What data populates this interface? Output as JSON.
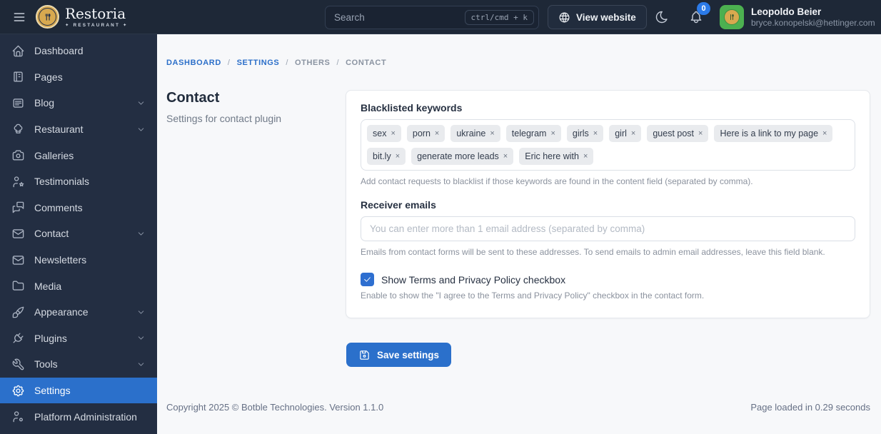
{
  "brand": {
    "name": "Restoria",
    "tagline": "✦ RESTAURANT ✦"
  },
  "topbar": {
    "search_placeholder": "Search",
    "search_shortcut": "ctrl/cmd + k",
    "view_website_label": "View website",
    "notification_count": "0",
    "user": {
      "name": "Leopoldo Beier",
      "email": "bryce.konopelski@hettinger.com"
    }
  },
  "sidebar": {
    "items": [
      {
        "label": "Dashboard"
      },
      {
        "label": "Pages"
      },
      {
        "label": "Blog",
        "expandable": true
      },
      {
        "label": "Restaurant",
        "expandable": true
      },
      {
        "label": "Galleries"
      },
      {
        "label": "Testimonials"
      },
      {
        "label": "Comments"
      },
      {
        "label": "Contact",
        "expandable": true
      },
      {
        "label": "Newsletters"
      },
      {
        "label": "Media"
      },
      {
        "label": "Appearance",
        "expandable": true
      },
      {
        "label": "Plugins",
        "expandable": true
      },
      {
        "label": "Tools",
        "expandable": true
      },
      {
        "label": "Settings",
        "active": true
      },
      {
        "label": "Platform Administration"
      }
    ]
  },
  "breadcrumb": {
    "separator": "/",
    "items": [
      "DASHBOARD",
      "SETTINGS",
      "OTHERS",
      "CONTACT"
    ]
  },
  "page": {
    "title": "Contact",
    "subtitle": "Settings for contact plugin"
  },
  "form": {
    "blacklist": {
      "label": "Blacklisted keywords",
      "remove_glyph": "×",
      "tags": [
        "sex",
        "porn",
        "ukraine",
        "telegram",
        "girls",
        "girl",
        "guest post",
        "Here is a link to my page",
        "bit.ly",
        "generate more leads",
        "Eric here with"
      ],
      "help": "Add contact requests to blacklist if those keywords are found in the content field (separated by comma)."
    },
    "receiver": {
      "label": "Receiver emails",
      "placeholder": "You can enter more than 1 email address (separated by comma)",
      "help": "Emails from contact forms will be sent to these addresses. To send emails to admin email addresses, leave this field blank."
    },
    "terms": {
      "label": "Show Terms and Privacy Policy checkbox",
      "checked": true,
      "help": "Enable to show the \"I agree to the Terms and Privacy Policy\" checkbox in the contact form."
    },
    "save_label": "Save settings"
  },
  "footer": {
    "left": "Copyright 2025 © Botble Technologies. Version 1.1.0",
    "right": "Page loaded in 0.29 seconds"
  },
  "colors": {
    "topbar_bg": "#1e2837",
    "sidebar_bg": "#232e42",
    "active_blue": "#2b70cb",
    "badge_blue": "#2b7ae8",
    "checkbox_blue": "#2e6fd0",
    "avatar_green": "#4cb050",
    "logo_gold": "#d8a94f",
    "content_bg": "#f7f8fa",
    "link_blue": "#2c6fc9"
  }
}
